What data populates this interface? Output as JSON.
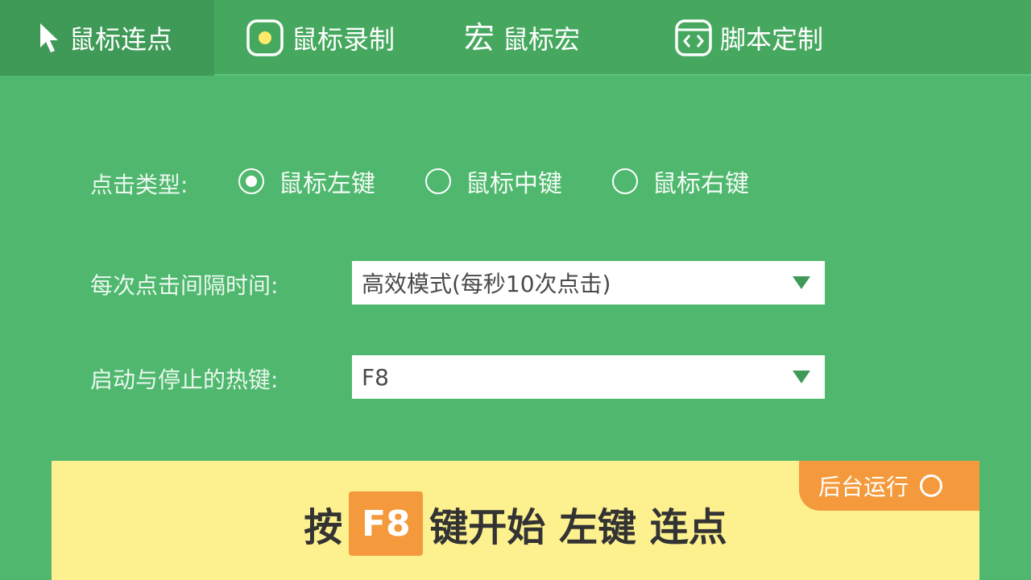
{
  "tabs": [
    {
      "label": "鼠标连点",
      "icon": "cursor-icon",
      "active": true
    },
    {
      "label": "鼠标录制",
      "icon": "record-icon",
      "active": false
    },
    {
      "label": "鼠标宏",
      "icon": "macro-icon",
      "icon_glyph": "宏",
      "active": false
    },
    {
      "label": "脚本定制",
      "icon": "code-script-icon",
      "active": false
    }
  ],
  "click_type": {
    "label": "点击类型:",
    "options": [
      "鼠标左键",
      "鼠标中键",
      "鼠标右键"
    ],
    "selected": "鼠标左键"
  },
  "interval": {
    "label": "每次点击间隔时间:",
    "value": "高效模式(每秒10次点击)"
  },
  "hotkey": {
    "label": "启动与停止的热键:",
    "value": "F8"
  },
  "banner": {
    "prefix": "按",
    "key": "F8",
    "suffix": "键开始 左键 连点",
    "background_run_label": "后台运行"
  },
  "colors": {
    "background": "#4fb86e",
    "tabbar": "#46a85f",
    "tab_active": "#3e9a56",
    "banner": "#fdf18f",
    "accent_orange": "#f49a3c"
  }
}
